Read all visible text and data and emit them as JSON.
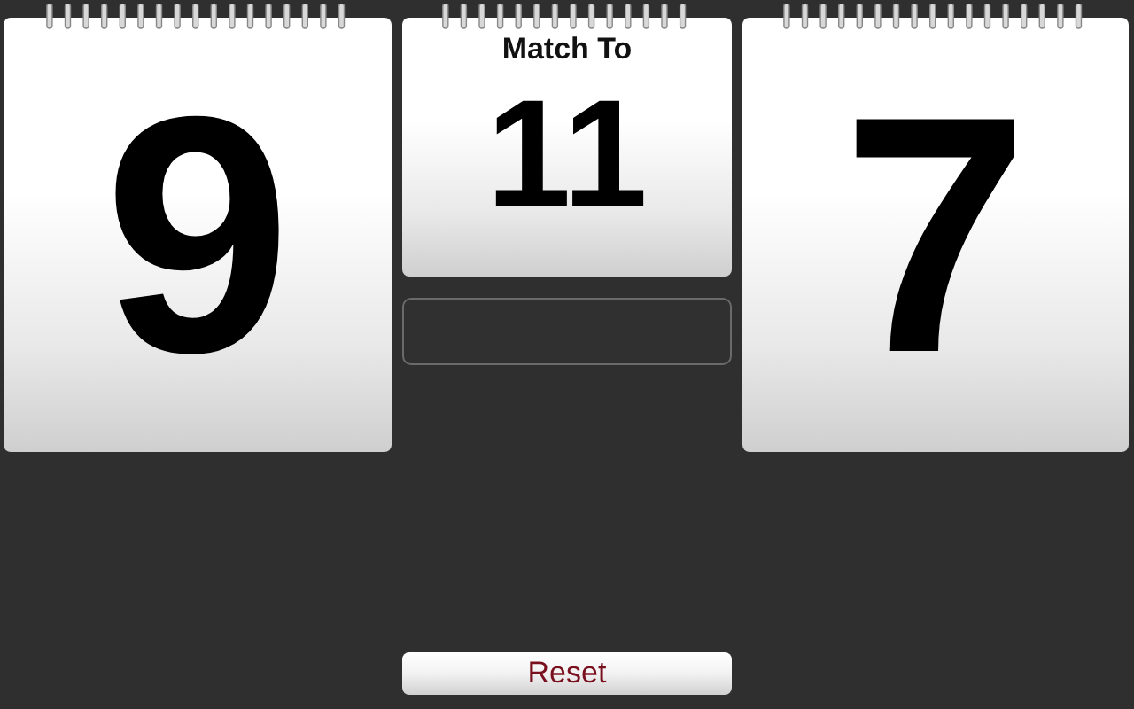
{
  "left_score": {
    "value": "9"
  },
  "match": {
    "title": "Match To",
    "value": "11"
  },
  "right_score": {
    "value": "7"
  },
  "reset_button": {
    "label": "Reset"
  }
}
